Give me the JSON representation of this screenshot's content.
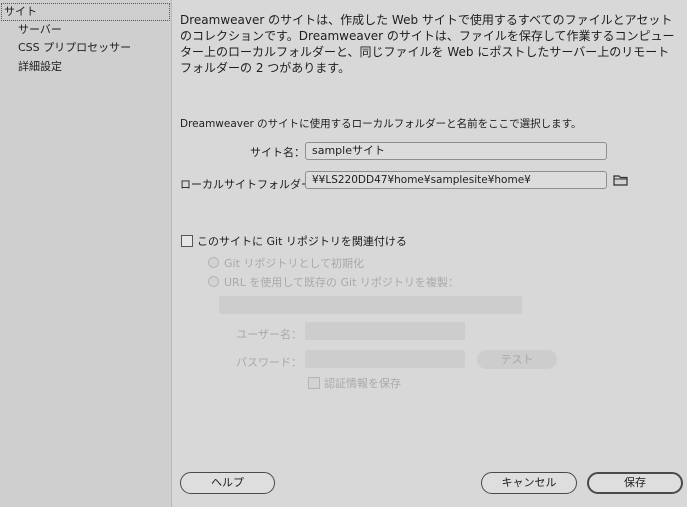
{
  "sidebar": {
    "items": [
      {
        "label": "サイト"
      },
      {
        "label": "サーバー"
      },
      {
        "label": "CSS プリプロセッサー"
      },
      {
        "label": "詳細設定"
      }
    ]
  },
  "main": {
    "description": "Dreamweaver のサイトは、作成した Web サイトで使用するすべてのファイルとアセットのコレクションです。Dreamweaver のサイトは、ファイルを保存して作業するコンピューター上のローカルフォルダーと、同じファイルを Web にポストしたサーバー上のリモートフォルダーの 2 つがあります。",
    "subtitle": "Dreamweaver のサイトに使用するローカルフォルダーと名前をここで選択します。",
    "site_name_label": "サイト名：",
    "site_name_value": "sampleサイト",
    "local_folder_label": "ローカルサイトフォルダー：",
    "local_folder_value": "¥¥LS220DD47¥home¥samplesite¥home¥",
    "git_checkbox_label": "このサイトに Git リポジトリを関連付ける",
    "git_init_label": "Git リポジトリとして初期化",
    "git_clone_label": "URL を使用して既存の Git リポジトリを複製：",
    "username_label": "ユーザー名：",
    "password_label": "パスワード：",
    "test_button": "テスト",
    "save_credentials_label": "認証情報を保存"
  },
  "footer": {
    "help_button": "ヘルプ",
    "cancel_button": "キャンセル",
    "save_button": "保存"
  },
  "icons": {
    "folder": "folder-icon"
  }
}
